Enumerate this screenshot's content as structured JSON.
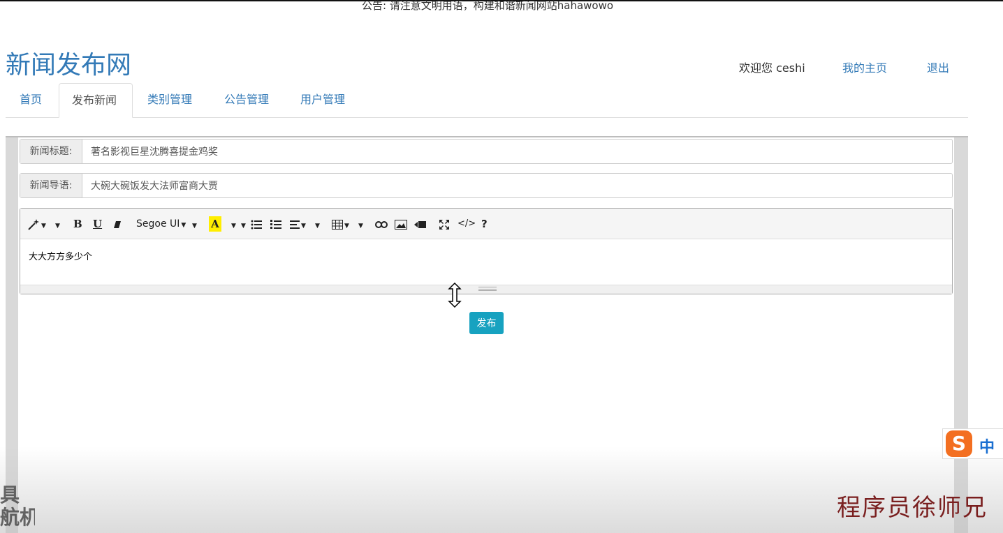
{
  "announcement": "公告: 请注意文明用语，构建和谐新闻网站hahawowo",
  "site_title": "新闻发布网",
  "user_nav": {
    "welcome": "欢迎您 ceshi",
    "my_home": "我的主页",
    "logout": "退出"
  },
  "tabs": [
    "首页",
    "发布新闻",
    "类别管理",
    "公告管理",
    "用户管理"
  ],
  "active_tab": "发布新闻",
  "form": {
    "title_label": "新闻标题:",
    "title_value": "著名影视巨星沈腾喜提金鸡奖",
    "lead_label": "新闻导语:",
    "lead_value": "大碗大碗饭发大法师富商大贾",
    "editor_font": "Segoe UI",
    "editor_content": "大大方方多少个",
    "submit_label": "发布"
  },
  "toolbar_icons": [
    "magic-wand-icon",
    "bold-icon",
    "underline-icon",
    "eraser-icon",
    "font-color-icon",
    "bullet-list-icon",
    "numbered-list-icon",
    "align-icon",
    "table-icon",
    "link-icon",
    "image-icon",
    "video-icon",
    "fullscreen-icon",
    "code-view-icon",
    "help-icon"
  ],
  "overlays": {
    "watermark": "程序员徐师兄",
    "ime_mode": "中",
    "corner_text": "具\n航机"
  },
  "colors": {
    "link": "#337ab7",
    "button": "#17a2c0",
    "watermark": "#7a1f1f",
    "ime_logo": "#f36f21"
  }
}
